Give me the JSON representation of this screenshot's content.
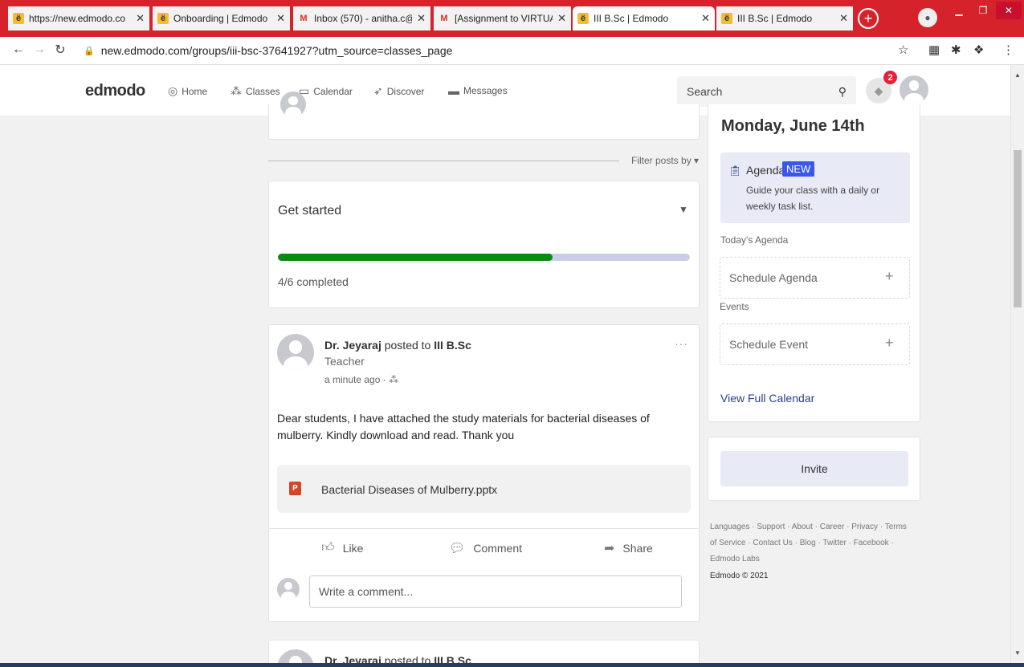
{
  "browser": {
    "tabs": [
      {
        "label": "https://new.edmodo.co",
        "favicon": "edmodo-icon",
        "active": false
      },
      {
        "label": "Onboarding | Edmodo",
        "favicon": "edmodo-icon",
        "active": false
      },
      {
        "label": "Inbox (570) - anitha.c@",
        "favicon": "gmail-icon",
        "active": false
      },
      {
        "label": "[Assignment to VIRTUA",
        "favicon": "gmail-icon",
        "active": false
      },
      {
        "label": "III B.Sc | Edmodo",
        "favicon": "edmodo-icon",
        "active": true
      },
      {
        "label": "III B.Sc | Edmodo",
        "favicon": "edmodo-icon",
        "active": false
      }
    ],
    "url": "new.edmodo.com/groups/iii-bsc-37641927?utm_source=classes_page",
    "theme_color": "#d6222b"
  },
  "edmodo": {
    "logo": "edmodo",
    "nav": [
      {
        "label": "Home",
        "icon": "home-icon"
      },
      {
        "label": "Classes",
        "icon": "classes-icon"
      },
      {
        "label": "Calendar",
        "icon": "calendar-icon"
      },
      {
        "label": "Discover",
        "icon": "discover-icon"
      },
      {
        "label": "Messages",
        "icon": "messages-icon"
      }
    ],
    "search_placeholder": "Search",
    "notification_count": "2",
    "accent_color": "#2a3f8a"
  },
  "feed": {
    "filter_label": "Filter posts by ▾",
    "get_started": {
      "title": "Get started",
      "completed_text": "4/6 completed",
      "completed": 4,
      "total": 6,
      "progress_color": "#098b12"
    },
    "post": {
      "author": "Dr. Jeyaraj",
      "posted_to_text": "posted to",
      "group": "III B.Sc",
      "role": "Teacher",
      "time": "a minute ago",
      "more": "···",
      "body": "Dear students, I have attached the study materials for bacterial diseases of mulberry. Kindly download and read. Thank you",
      "attachment": "Bacterial Diseases of Mulberry.pptx",
      "actions": {
        "like": "Like",
        "comment": "Comment",
        "share": "Share"
      },
      "comment_placeholder": "Write a comment..."
    },
    "next_post": {
      "author": "Dr. Jeyaraj",
      "posted_to_text": "posted to",
      "group": "III B.Sc"
    }
  },
  "sidebar": {
    "date": "Monday, June 14th",
    "agenda": {
      "title": "Agenda",
      "badge": "NEW",
      "description": "Guide your class with a daily or weekly task list."
    },
    "todays_agenda_label": "Today's Agenda",
    "schedule_agenda": "Schedule Agenda",
    "events_label": "Events",
    "schedule_event": "Schedule Event",
    "view_full_calendar": "View Full Calendar",
    "invite": "Invite",
    "footer_links": "Languages · Support · About · Career · Privacy · Terms of Service · Contact Us · Blog · Twitter · Facebook · Edmodo Labs",
    "copyright": "Edmodo © 2021"
  }
}
